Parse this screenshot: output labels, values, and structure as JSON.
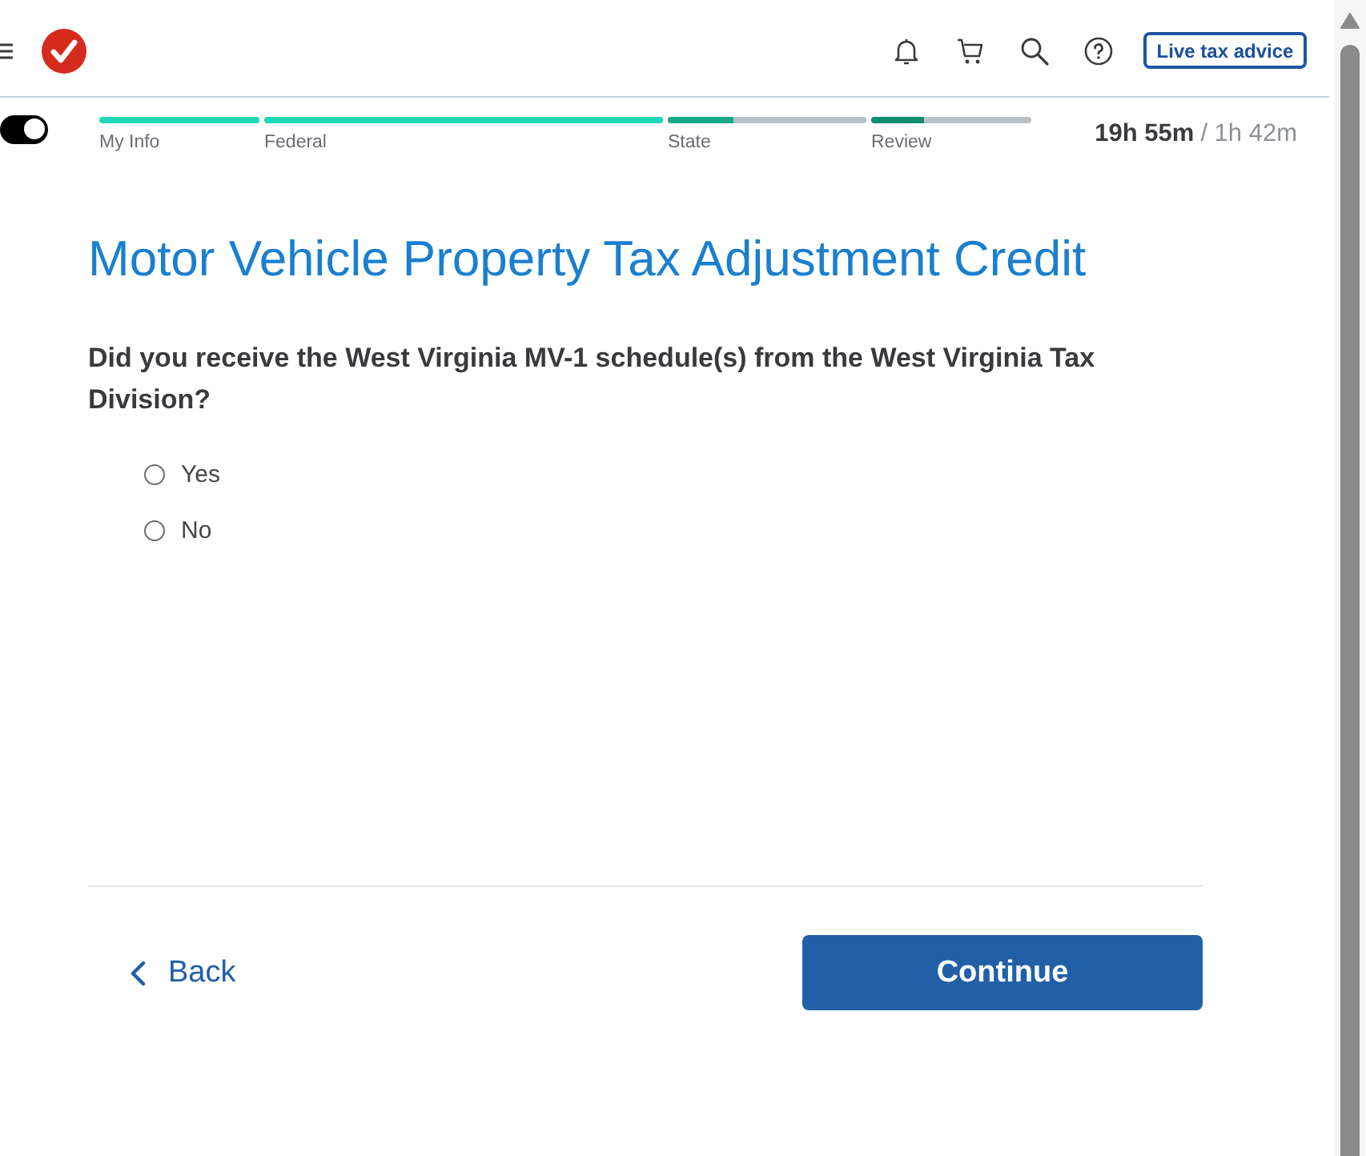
{
  "header": {
    "advice_button": "Live tax advice"
  },
  "progress": {
    "toggle": {
      "on": true
    },
    "steps": [
      {
        "label": "My Info",
        "level": 1,
        "color": "#1dd8b4"
      },
      {
        "label": "Federal",
        "level": 1,
        "color": "#1dd8b4"
      },
      {
        "label": "State",
        "level": 0.33,
        "color": "#17a88c"
      },
      {
        "label": "Review",
        "level": 0.33,
        "color": "#108c70"
      }
    ],
    "timer": {
      "elapsed": "19h 55m",
      "total": "/ 1h 42m"
    }
  },
  "page": {
    "title": "Motor Vehicle Property Tax Adjustment Credit",
    "question": "Did you receive the West Virginia MV-1 schedule(s) from the West Virginia Tax Division?",
    "options": [
      {
        "label": "Yes",
        "selected": false
      },
      {
        "label": "No",
        "selected": false
      }
    ]
  },
  "footer": {
    "back": "Back",
    "continue": "Continue"
  }
}
